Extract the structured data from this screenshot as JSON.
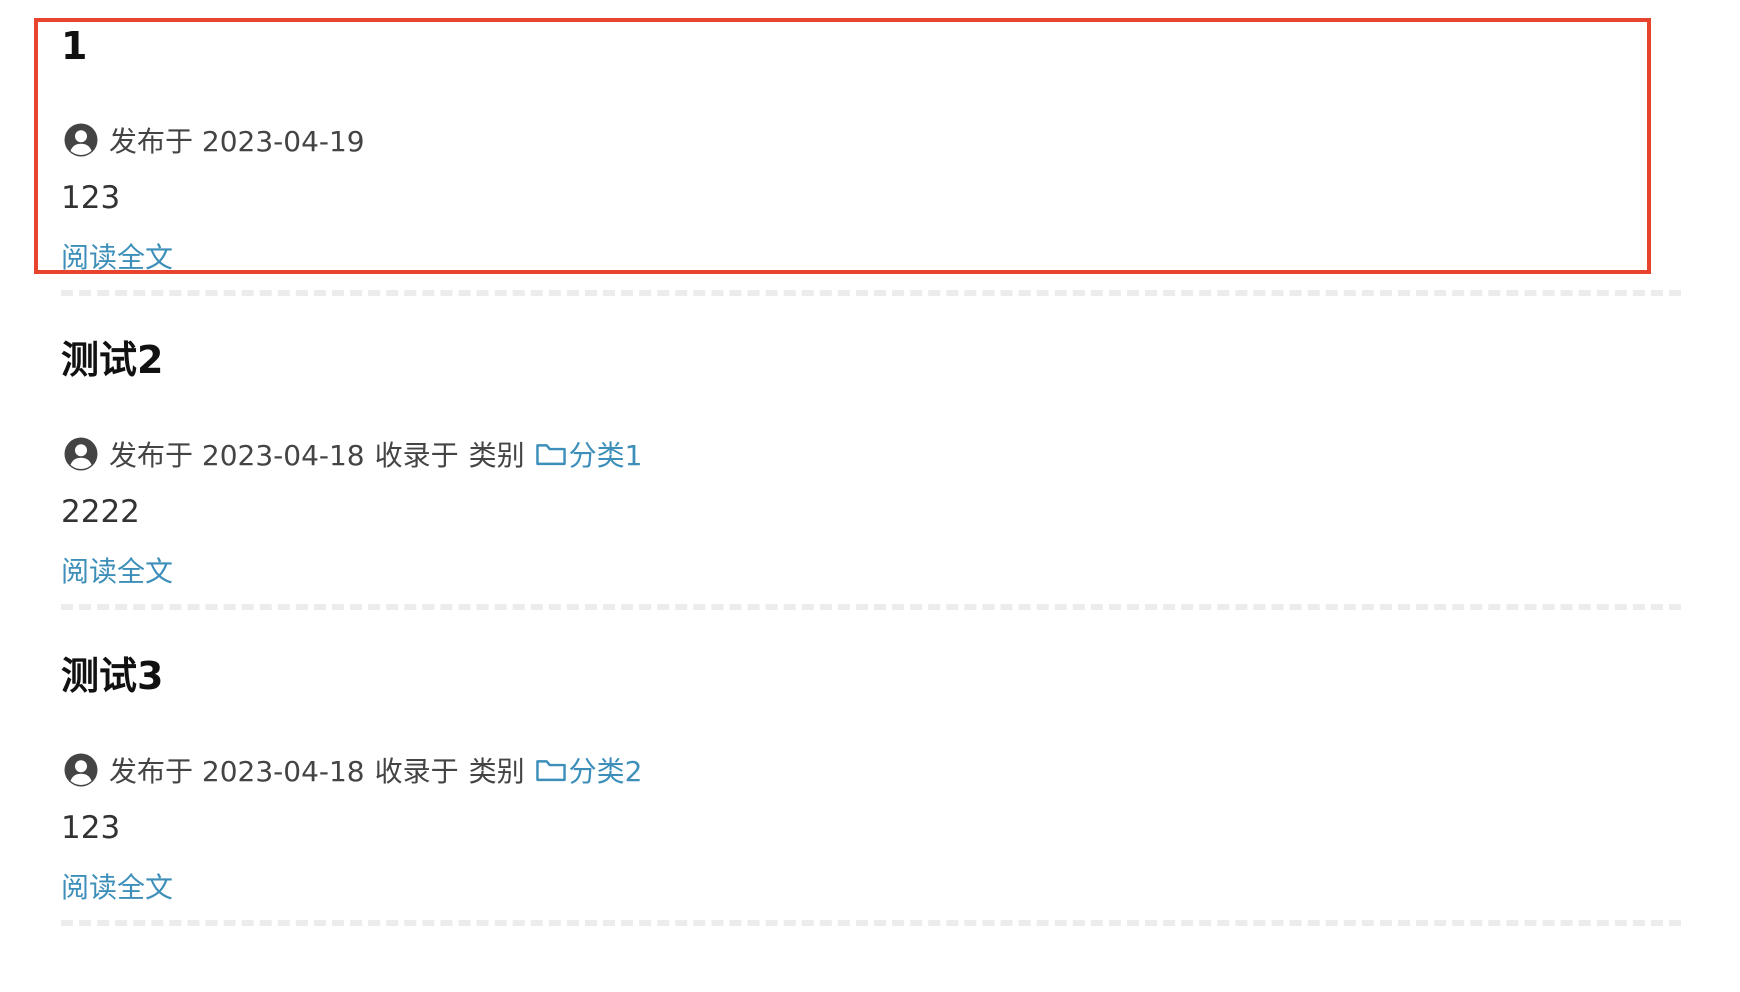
{
  "colors": {
    "link": "#3d8fba",
    "highlight": "#e8432d",
    "divider": "#ececec"
  },
  "icons": {
    "author": "user-circle-icon",
    "category": "folder-icon"
  },
  "posts": [
    {
      "title": "1",
      "published": "发布于 2023-04-19",
      "collected": "",
      "category_label": "",
      "category": "",
      "excerpt": "123",
      "read_more": "阅读全文"
    },
    {
      "title": "测试2",
      "published": "发布于 2023-04-18",
      "collected": "收录于",
      "category_label": "类别",
      "category": "分类1",
      "excerpt": "2222",
      "read_more": "阅读全文"
    },
    {
      "title": "测试3",
      "published": "发布于 2023-04-18",
      "collected": "收录于",
      "category_label": "类别",
      "category": "分类2",
      "excerpt": "123",
      "read_more": "阅读全文"
    }
  ]
}
